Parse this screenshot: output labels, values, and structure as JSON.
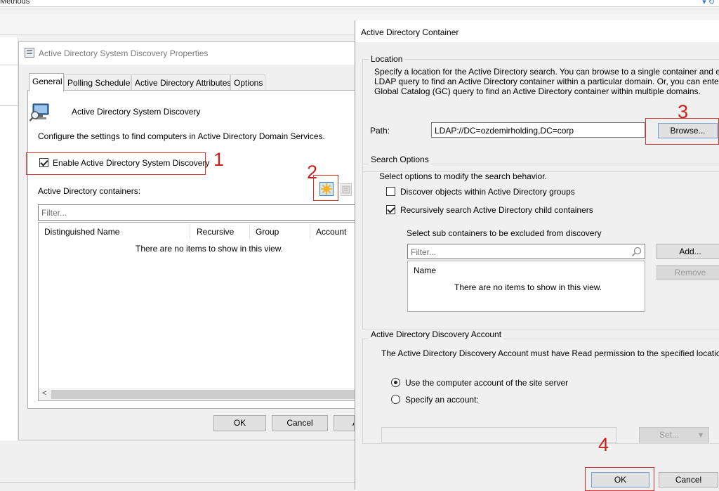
{
  "background_app": {
    "top_text": "Methods"
  },
  "properties_dialog": {
    "title": "Active Directory System Discovery Properties",
    "tabs": [
      "General",
      "Polling Schedule",
      "Active Directory Attributes",
      "Options"
    ],
    "header_text": "Active Directory System Discovery",
    "description": "Configure the settings to find computers in Active Directory Domain Services.",
    "enable_checkbox_label": "Enable Active Directory System Discovery",
    "containers_label": "Active Directory containers:",
    "filter_placeholder": "Filter...",
    "columns": [
      "Distinguished Name",
      "Recursive",
      "Group",
      "Account"
    ],
    "empty_text": "There are no items to show in this view.",
    "ok_label": "OK",
    "cancel_label": "Cancel",
    "apply_label": "A"
  },
  "ad_container_dialog": {
    "title": "Active Directory Container",
    "location_group": "Location",
    "location_desc_1": "Specify a location for the Active Directory search. You can browse to a single container and enter a",
    "location_desc_2": "LDAP query to find an Active Directory container within a particular domain. Or, you can enter a",
    "location_desc_3": "Global Catalog (GC) query to find an Active Directory container within multiple domains.",
    "path_label": "Path:",
    "path_value": "LDAP://DC=ozdemirholding,DC=corp",
    "browse_label": "Browse...",
    "search_group": "Search Options",
    "search_desc": "Select options to modify the search behavior.",
    "discover_groups_label": "Discover objects within Active Directory groups",
    "recursive_label": "Recursively search Active Directory child containers",
    "exclude_label": "Select sub containers to be excluded from discovery",
    "exclude_filter_placeholder": "Filter...",
    "exclude_column": "Name",
    "exclude_empty": "There are no items to show in this view.",
    "add_label": "Add...",
    "remove_label": "Remove",
    "account_group": "Active Directory Discovery Account",
    "account_desc": "The Active Directory Discovery Account must have Read permission to the specified location.",
    "radio_computer_label": "Use the computer account of the site server",
    "radio_specify_label": "Specify an account:",
    "set_label": "Set...",
    "ok_label": "OK",
    "cancel_label": "Cancel"
  },
  "annotations": {
    "step1": "1",
    "step2": "2",
    "step3": "3",
    "step4": "4"
  },
  "colors": {
    "annotation_red": "#c8211b",
    "window_bg": "#f0f0f0"
  }
}
